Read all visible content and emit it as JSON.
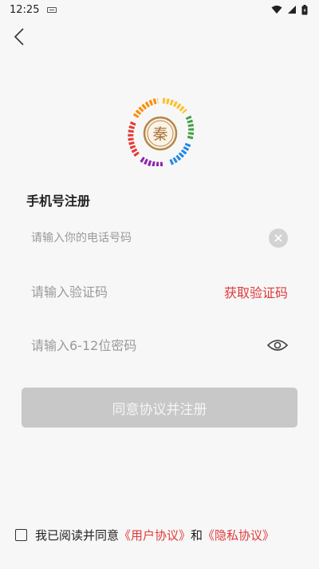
{
  "status_bar": {
    "time": "12:25",
    "icons": [
      "keyboard-icon",
      "wifi-icon",
      "signal-icon",
      "battery-icon"
    ]
  },
  "header": {
    "back_icon": "chevron-left-icon"
  },
  "logo": {
    "text": "秦",
    "colors": [
      "#e53935",
      "#fbc02d",
      "#43a047",
      "#1e88e5",
      "#8e24aa",
      "#b5864a"
    ]
  },
  "title": "手机号注册",
  "form": {
    "phone_placeholder": "请输入你的电话号码",
    "code_placeholder": "请输入验证码",
    "get_code_label": "获取验证码",
    "password_placeholder": "请输入6-12位密码",
    "submit_label": "同意协议并注册"
  },
  "agreement": {
    "prefix": "我已阅读并同意",
    "user_agreement": "《用户协议》",
    "conjunction": "和",
    "privacy_policy": "《隐私协议》"
  },
  "colors": {
    "accent": "#e03a3a",
    "disabled_button": "#c8c8c8",
    "background": "#f7f7f7"
  }
}
